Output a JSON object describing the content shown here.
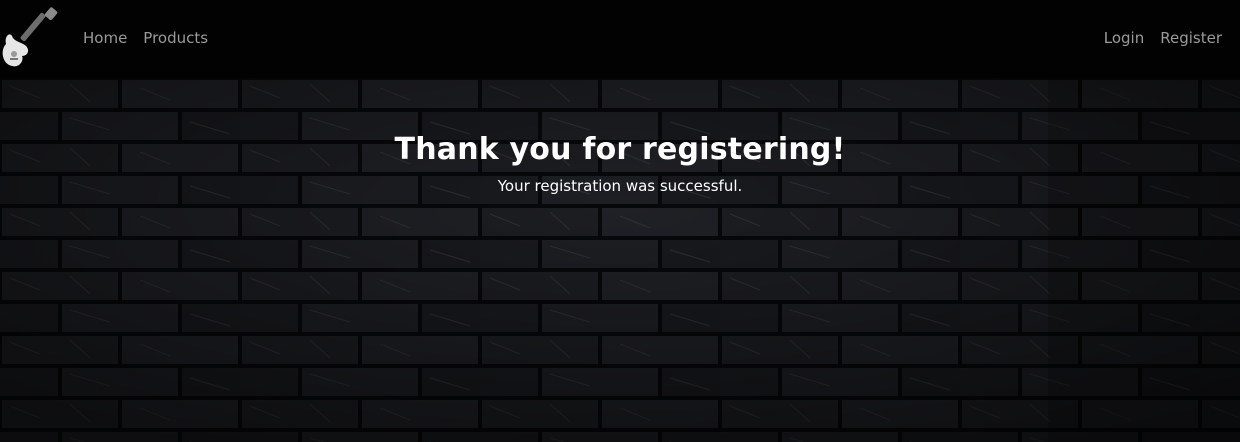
{
  "nav": {
    "logo_icon": "electric-guitar-icon",
    "left_links": [
      "Home",
      "Products"
    ],
    "right_links": [
      "Login",
      "Register"
    ]
  },
  "hero": {
    "background": "dark-brick-wall",
    "title": "Thank you for registering!",
    "message": "Your registration was successful."
  },
  "colors": {
    "navbar_bg": "#020202",
    "nav_link": "#9a9a9a",
    "hero_text": "#ffffff",
    "brick_dark": "#1b1c20",
    "mortar": "#07080a"
  }
}
